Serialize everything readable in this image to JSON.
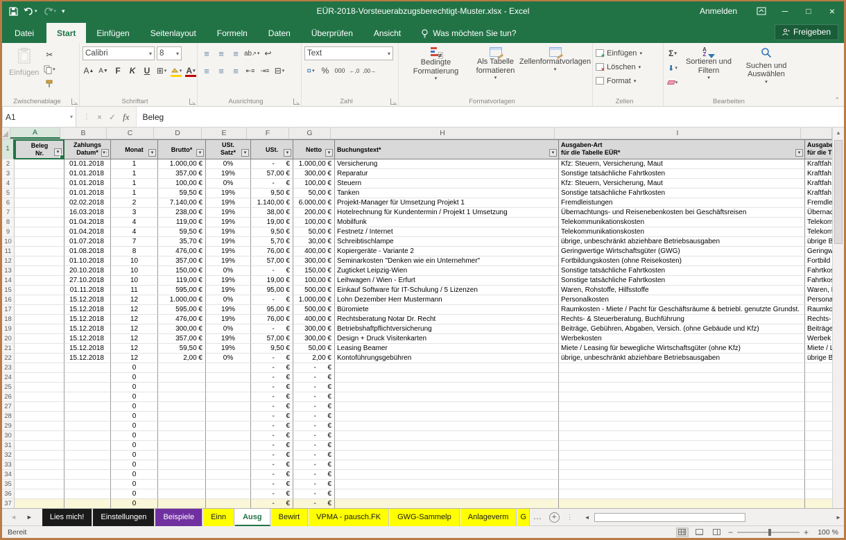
{
  "window": {
    "title": "EÜR-2018-Vorsteuerabzugsberechtigt-Muster.xlsx - Excel",
    "signin": "Anmelden",
    "share": "Freigeben",
    "minimize": "─",
    "maximize": "□",
    "close": "×"
  },
  "menu": {
    "file": "Datei",
    "tabs": [
      {
        "label": "Start",
        "cls": "active"
      },
      {
        "label": "Einfügen"
      },
      {
        "label": "Seitenlayout"
      },
      {
        "label": "Formeln"
      },
      {
        "label": "Daten"
      },
      {
        "label": "Überprüfen"
      },
      {
        "label": "Ansicht"
      }
    ],
    "tellme": "Was möchten Sie tun?"
  },
  "ribbon": {
    "groups": {
      "clipboard": "Zwischenablage",
      "font": "Schriftart",
      "alignment": "Ausrichtung",
      "number": "Zahl",
      "styles": "Formatvorlagen",
      "cells": "Zellen",
      "editing": "Bearbeiten"
    },
    "paste_label": "Einfügen",
    "font_name": "Calibri",
    "font_size": "8",
    "bold": "F",
    "italic": "K",
    "underline": "U",
    "number_format": "Text",
    "percent_label": "%",
    "thousands_label": "000",
    "inc_dec_label": "←,0",
    "dec_dec_label": ",00→",
    "cond_format_label": "Bedingte Formatierung",
    "format_table_label": "Als Tabelle formatieren",
    "cell_styles_label": "Zellenformatvorlagen",
    "insert_cells_label": "Einfügen",
    "delete_cells_label": "Löschen",
    "format_cells_label": "Format",
    "sort_filter_label": "Sortieren und Filtern",
    "find_select_label": "Suchen und Auswählen"
  },
  "formula_bar": {
    "name_box": "A1",
    "fx": "fx",
    "content": "Beleg"
  },
  "grid": {
    "header_row_number": "1",
    "columns": [
      {
        "label": "A",
        "cls": "cA selhdr"
      },
      {
        "label": "B",
        "cls": "cB"
      },
      {
        "label": "C",
        "cls": "cC"
      },
      {
        "label": "D",
        "cls": "cD"
      },
      {
        "label": "E",
        "cls": "cE"
      },
      {
        "label": "F",
        "cls": "cF"
      },
      {
        "label": "G",
        "cls": "cG"
      },
      {
        "label": "H",
        "cls": "cH"
      },
      {
        "label": "I",
        "cls": "cI"
      },
      {
        "label": "",
        "cls": "cJ"
      }
    ],
    "headers": {
      "a1": "Beleg",
      "a2": "Nr.",
      "b1": "Zahlungs",
      "b2": "Datum*",
      "c": "Monat",
      "d": "Brutto*",
      "e1": "USt.",
      "e2": "Satz*",
      "f": "USt.",
      "g": "Netto",
      "h": "Buchungstext*",
      "i1": "Ausgaben-Art",
      "i2": "für die Tabelle EÜR*",
      "j1": "Ausgabe",
      "j2": "für die T"
    },
    "rows": [
      {
        "n": "2",
        "b": "01.01.2018",
        "c": "1",
        "d": "1.000,00 €",
        "e": "0%",
        "f": "-      €",
        "g": "1.000,00 €",
        "h": "Versicherung",
        "i": "Kfz: Steuern, Versicherung, Maut",
        "j": "Kraftfah"
      },
      {
        "n": "3",
        "b": "01.01.2018",
        "c": "1",
        "d": "357,00 €",
        "e": "19%",
        "f": "57,00 €",
        "g": "300,00 €",
        "h": "Reparatur",
        "i": "Sonstige tatsächliche Fahrtkosten",
        "j": "Kraftfah"
      },
      {
        "n": "4",
        "b": "01.01.2018",
        "c": "1",
        "d": "100,00 €",
        "e": "0%",
        "f": "-      €",
        "g": "100,00 €",
        "h": "Steuern",
        "i": "Kfz: Steuern, Versicherung, Maut",
        "j": "Kraftfah"
      },
      {
        "n": "5",
        "b": "01.01.2018",
        "c": "1",
        "d": "59,50 €",
        "e": "19%",
        "f": "9,50 €",
        "g": "50,00 €",
        "h": "Tanken",
        "i": "Sonstige tatsächliche Fahrtkosten",
        "j": "Kraftfah"
      },
      {
        "n": "6",
        "b": "02.02.2018",
        "c": "2",
        "d": "7.140,00 €",
        "e": "19%",
        "f": "1.140,00 €",
        "g": "6.000,00 €",
        "h": "Projekt-Manager für Umsetzung Projekt 1",
        "i": "Fremdleistungen",
        "j": "Fremdle"
      },
      {
        "n": "7",
        "b": "16.03.2018",
        "c": "3",
        "d": "238,00 €",
        "e": "19%",
        "f": "38,00 €",
        "g": "200,00 €",
        "h": "Hotelrechnung für Kundentermin / Projekt 1 Umsetzung",
        "i": "Übernachtungs- und Reisenebenkosten bei Geschäftsreisen",
        "j": "Übernac"
      },
      {
        "n": "8",
        "b": "01.04.2018",
        "c": "4",
        "d": "119,00 €",
        "e": "19%",
        "f": "19,00 €",
        "g": "100,00 €",
        "h": "Mobilfunk",
        "i": "Telekommunikationskosten",
        "j": "Telekom"
      },
      {
        "n": "9",
        "b": "01.04.2018",
        "c": "4",
        "d": "59,50 €",
        "e": "19%",
        "f": "9,50 €",
        "g": "50,00 €",
        "h": "Festnetz / Internet",
        "i": "Telekommunikationskosten",
        "j": "Telekom"
      },
      {
        "n": "10",
        "b": "01.07.2018",
        "c": "7",
        "d": "35,70 €",
        "e": "19%",
        "f": "5,70 €",
        "g": "30,00 €",
        "h": "Schreibtischlampe",
        "i": "übrige, unbeschränkt abziehbare Betriebsausgaben",
        "j": "übrige B"
      },
      {
        "n": "11",
        "b": "01.08.2018",
        "c": "8",
        "d": "476,00 €",
        "e": "19%",
        "f": "76,00 €",
        "g": "400,00 €",
        "h": "Kopiergeräte - Variante 2",
        "i": "Geringwertige Wirtschaftsgüter (GWG)",
        "j": "Geringw"
      },
      {
        "n": "12",
        "b": "01.10.2018",
        "c": "10",
        "d": "357,00 €",
        "e": "19%",
        "f": "57,00 €",
        "g": "300,00 €",
        "h": "Seminarkosten \"Denken wie ein Unternehmer\"",
        "i": "Fortbildungskosten (ohne Reisekosten)",
        "j": "Fortbild"
      },
      {
        "n": "13",
        "b": "20.10.2018",
        "c": "10",
        "d": "150,00 €",
        "e": "0%",
        "f": "-      €",
        "g": "150,00 €",
        "h": "Zugticket Leipzig-Wien",
        "i": "Sonstige tatsächliche Fahrtkosten",
        "j": "Fahrtkos"
      },
      {
        "n": "14",
        "b": "27.10.2018",
        "c": "10",
        "d": "119,00 €",
        "e": "19%",
        "f": "19,00 €",
        "g": "100,00 €",
        "h": "Leihwagen / Wien - Erfurt",
        "i": "Sonstige tatsächliche Fahrtkosten",
        "j": "Fahrtkos"
      },
      {
        "n": "15",
        "b": "01.11.2018",
        "c": "11",
        "d": "595,00 €",
        "e": "19%",
        "f": "95,00 €",
        "g": "500,00 €",
        "h": "Einkauf Software für IT-Schulung / 5 Lizenzen",
        "i": "Waren, Rohstoffe, Hilfsstoffe",
        "j": "Waren, R"
      },
      {
        "n": "16",
        "b": "15.12.2018",
        "c": "12",
        "d": "1.000,00 €",
        "e": "0%",
        "f": "-      €",
        "g": "1.000,00 €",
        "h": "Lohn Dezember Herr Mustermann",
        "i": "Personalkosten",
        "j": "Persona"
      },
      {
        "n": "17",
        "b": "15.12.2018",
        "c": "12",
        "d": "595,00 €",
        "e": "19%",
        "f": "95,00 €",
        "g": "500,00 €",
        "h": "Büromiete",
        "i": "Raumkosten - Miete / Pacht für Geschäftsräume & betriebl. genutzte Grundst.",
        "j": "Raumko"
      },
      {
        "n": "18",
        "b": "15.12.2018",
        "c": "12",
        "d": "476,00 €",
        "e": "19%",
        "f": "76,00 €",
        "g": "400,00 €",
        "h": "Rechtsberatung Notar Dr. Recht",
        "i": "Rechts- & Steuerberatung, Buchführung",
        "j": "Rechts-"
      },
      {
        "n": "19",
        "b": "15.12.2018",
        "c": "12",
        "d": "300,00 €",
        "e": "0%",
        "f": "-      €",
        "g": "300,00 €",
        "h": "Betriebshaftpflichtversicherung",
        "i": "Beiträge, Gebühren, Abgaben, Versich. (ohne Gebäude und Kfz)",
        "j": "Beiträge"
      },
      {
        "n": "20",
        "b": "15.12.2018",
        "c": "12",
        "d": "357,00 €",
        "e": "19%",
        "f": "57,00 €",
        "g": "300,00 €",
        "h": "Design + Druck Visitenkarten",
        "i": "Werbekosten",
        "j": "Werbek"
      },
      {
        "n": "21",
        "b": "15.12.2018",
        "c": "12",
        "d": "59,50 €",
        "e": "19%",
        "f": "9,50 €",
        "g": "50,00 €",
        "h": "Leasing Beamer",
        "i": "Miete / Leasing für bewegliche Wirtschaftsgüter (ohne Kfz)",
        "j": "Miete / L"
      },
      {
        "n": "22",
        "b": "15.12.2018",
        "c": "12",
        "d": "2,00 €",
        "e": "0%",
        "f": "-      €",
        "g": "2,00 €",
        "h": "Kontoführungsgebühren",
        "i": "übrige, unbeschränkt abziehbare Betriebsausgaben",
        "j": "übrige B"
      },
      {
        "n": "23",
        "b": "",
        "c": "0",
        "d": "",
        "e": "",
        "f": "-      €",
        "g": "-      €",
        "h": "",
        "i": "",
        "j": ""
      },
      {
        "n": "24",
        "b": "",
        "c": "0",
        "d": "",
        "e": "",
        "f": "-      €",
        "g": "-      €",
        "h": "",
        "i": "",
        "j": ""
      },
      {
        "n": "25",
        "b": "",
        "c": "0",
        "d": "",
        "e": "",
        "f": "-      €",
        "g": "-      €",
        "h": "",
        "i": "",
        "j": ""
      },
      {
        "n": "26",
        "b": "",
        "c": "0",
        "d": "",
        "e": "",
        "f": "-      €",
        "g": "-      €",
        "h": "",
        "i": "",
        "j": ""
      },
      {
        "n": "27",
        "b": "",
        "c": "0",
        "d": "",
        "e": "",
        "f": "-      €",
        "g": "-      €",
        "h": "",
        "i": "",
        "j": ""
      },
      {
        "n": "28",
        "b": "",
        "c": "0",
        "d": "",
        "e": "",
        "f": "-      €",
        "g": "-      €",
        "h": "",
        "i": "",
        "j": ""
      },
      {
        "n": "29",
        "b": "",
        "c": "0",
        "d": "",
        "e": "",
        "f": "-      €",
        "g": "-      €",
        "h": "",
        "i": "",
        "j": ""
      },
      {
        "n": "30",
        "b": "",
        "c": "0",
        "d": "",
        "e": "",
        "f": "-      €",
        "g": "-      €",
        "h": "",
        "i": "",
        "j": ""
      },
      {
        "n": "31",
        "b": "",
        "c": "0",
        "d": "",
        "e": "",
        "f": "-      €",
        "g": "-      €",
        "h": "",
        "i": "",
        "j": ""
      },
      {
        "n": "32",
        "b": "",
        "c": "0",
        "d": "",
        "e": "",
        "f": "-      €",
        "g": "-      €",
        "h": "",
        "i": "",
        "j": ""
      },
      {
        "n": "33",
        "b": "",
        "c": "0",
        "d": "",
        "e": "",
        "f": "-      €",
        "g": "-      €",
        "h": "",
        "i": "",
        "j": ""
      },
      {
        "n": "34",
        "b": "",
        "c": "0",
        "d": "",
        "e": "",
        "f": "-      €",
        "g": "-      €",
        "h": "",
        "i": "",
        "j": ""
      },
      {
        "n": "35",
        "b": "",
        "c": "0",
        "d": "",
        "e": "",
        "f": "-      €",
        "g": "-      €",
        "h": "",
        "i": "",
        "j": ""
      },
      {
        "n": "36",
        "b": "",
        "c": "0",
        "d": "",
        "e": "",
        "f": "-      €",
        "g": "-      €",
        "h": "",
        "i": "",
        "j": ""
      },
      {
        "n": "37",
        "b": "",
        "c": "0",
        "d": "",
        "e": "",
        "f": "-      €",
        "g": "-      €",
        "h": "",
        "i": "",
        "j": "",
        "cls": "row-cut"
      }
    ]
  },
  "sheet_tabs": {
    "tabs": [
      {
        "label": "Lies mich!",
        "cls": "tab-black"
      },
      {
        "label": "Einstellungen",
        "cls": "tab-black"
      },
      {
        "label": "Beispiele",
        "cls": "tab-purple"
      },
      {
        "label": "Einn",
        "cls": "tab-yellow"
      },
      {
        "label": "Ausg",
        "cls": "tab-active"
      },
      {
        "label": "Bewirt",
        "cls": "tab-yellow"
      },
      {
        "label": "VPMA - pausch.FK",
        "cls": "tab-yellow"
      },
      {
        "label": "GWG-Sammelp",
        "cls": "tab-yellow"
      },
      {
        "label": "Anlageverm",
        "cls": "tab-yellow"
      },
      {
        "label": "G",
        "cls": "tab-yellow tab-cut"
      }
    ],
    "overflow": "..."
  },
  "status": {
    "ready": "Bereit",
    "zoom": "100 %"
  }
}
